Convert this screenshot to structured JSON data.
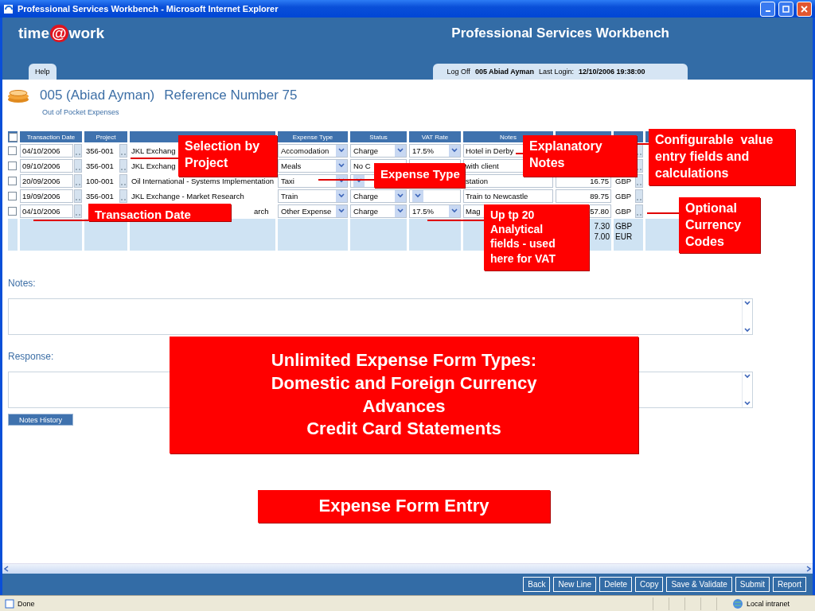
{
  "window": {
    "title": "Professional Services Workbench - Microsoft Internet Explorer"
  },
  "header": {
    "logo_parts": [
      "time",
      "@",
      "work"
    ],
    "title": "Professional Services Workbench",
    "help_tab": "Help",
    "log_off": "Log Off",
    "user": "005 Abiad Ayman",
    "last_login_label": "Last Login:",
    "last_login": "12/10/2006 19:38:00"
  },
  "page": {
    "heading": "005 (Abiad Ayman)",
    "reference": "Reference Number 75",
    "subheading": "Out of Pocket Expenses"
  },
  "table": {
    "select_all": {
      "checked": false
    },
    "columns": [
      {
        "label": "Transaction Date"
      },
      {
        "label": "Project"
      },
      {
        "label": "Expense Type"
      },
      {
        "label": "Status"
      },
      {
        "label": "VAT Rate"
      },
      {
        "label": "Notes"
      }
    ],
    "rows": [
      {
        "checked": false,
        "date": "04/10/2006",
        "project": "356-001",
        "project_name": "JKL Exchang",
        "expense_type": "Accomodation",
        "status": "Charge",
        "vat_rate": "17.5%",
        "notes": "Hotel in Derby"
      },
      {
        "checked": false,
        "date": "09/10/2006",
        "project": "356-001",
        "project_name": "JKL Exchang",
        "expense_type": "Meals",
        "status": "No C",
        "notes": "with client"
      },
      {
        "checked": false,
        "date": "20/09/2006",
        "project": "100-001",
        "project_name": "Oil International - Systems Implementation",
        "expense_type": "Taxi",
        "notes": "station",
        "amount": "16.75",
        "currency": "GBP"
      },
      {
        "checked": false,
        "date": "19/09/2006",
        "project": "356-001",
        "project_name": "JKL Exchange - Market Research",
        "expense_type": "Train",
        "status": "Charge",
        "notes": "Train to Newcastle",
        "amount": "89.75",
        "currency": "GBP"
      },
      {
        "checked": false,
        "date": "04/10/2006",
        "project_name": "arch",
        "expense_type": "Other Expense",
        "status": "Charge",
        "vat_rate": "17.5%",
        "notes": "Mag",
        "amount": "57.80",
        "currency": "GBP"
      }
    ],
    "totals": [
      {
        "amount": "7.30",
        "currency": "GBP"
      },
      {
        "amount": "7.00",
        "currency": "EUR"
      }
    ]
  },
  "notes_label": "Notes:",
  "response_label": "Response:",
  "notes_history_button": "Notes History",
  "footer_buttons": [
    "Back",
    "New Line",
    "Delete",
    "Copy",
    "Save & Validate",
    "Submit",
    "Report"
  ],
  "status_bar": {
    "text": "Done",
    "zone": "Local intranet"
  },
  "callouts": [
    {
      "lines": [
        "Selection by",
        "Project"
      ]
    },
    {
      "lines": [
        "Expense Type"
      ]
    },
    {
      "lines": [
        "Explanatory",
        "Notes"
      ]
    },
    {
      "lines": [
        "Configurable  value",
        "entry fields and",
        "calculations"
      ]
    },
    {
      "lines": [
        "Transaction Date"
      ]
    },
    {
      "lines": [
        "Up tp 20",
        "Analytical",
        "fields - used",
        "here for VAT"
      ]
    },
    {
      "lines": [
        "Optional",
        "Currency",
        "Codes"
      ]
    },
    {
      "lines": [
        "Unlimited Expense Form Types:",
        "Domestic and Foreign Currency",
        "Advances",
        "Credit Card Statements"
      ]
    },
    {
      "lines": [
        "Expense Form Entry"
      ]
    }
  ]
}
